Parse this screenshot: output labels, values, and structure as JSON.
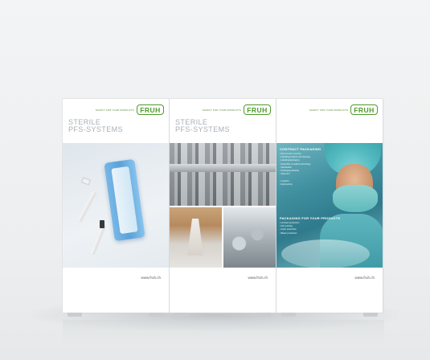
{
  "brand": {
    "tagline": "SAFETY FOR YOUR PRODUCTS",
    "logo_text": "FRUH",
    "accent_color": "#4f9a2c"
  },
  "panels": [
    {
      "title_line1": "STERILE",
      "title_line2": "PFS-SYSTEMS",
      "url": "www.fruh.ch"
    },
    {
      "title_line1": "STERILE",
      "title_line2": "PFS-SYSTEMS",
      "url": "www.fruh.ch"
    },
    {
      "url": "www.fruh.ch",
      "section1": {
        "heading": "CONTRACT PACKAGING",
        "items": [
          "• Door-to-door services",
          "• Handling products and cleaning",
          "• Labelling/packaging",
          "• Assembly of medical technology",
          "• Sterilisation",
          "• Packaging labelling",
          "• Shipment",
          "",
          "• Logistics",
          "• Engineering"
        ]
      },
      "section2": {
        "heading": "PACKAGING FOR YOUR PRODUCTS",
        "items": [
          "• Contract production",
          "• Film printing",
          "• Insert production",
          "• Blister production"
        ]
      }
    }
  ]
}
